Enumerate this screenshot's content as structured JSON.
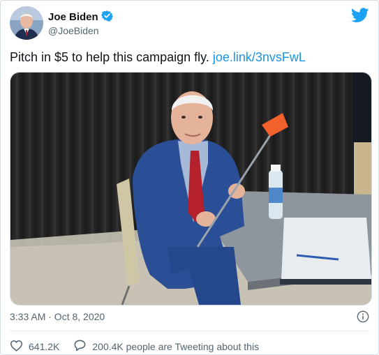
{
  "author": {
    "name": "Joe Biden",
    "handle": "@JoeBiden"
  },
  "tweet": {
    "text": "Pitch in $5 to help this campaign fly. ",
    "link": "joe.link/3nvsFwL"
  },
  "timestamp": "3:33 AM · Oct 8, 2020",
  "stats": {
    "likes": "641.2K",
    "conversation": "200.4K people are Tweeting about this"
  },
  "colors": {
    "brand": "#1da1f2",
    "link": "#1b95e0",
    "verified": "#1da1f2"
  },
  "icons": [
    "verified-icon",
    "twitter-bird-icon",
    "info-icon",
    "heart-icon",
    "comment-icon"
  ]
}
